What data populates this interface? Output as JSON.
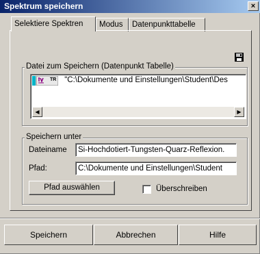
{
  "window": {
    "title": "Spektrum speichern",
    "close_glyph": "×"
  },
  "tabs": [
    {
      "label": "Selektiere Spektren",
      "active": true
    },
    {
      "label": "Modus",
      "active": false
    },
    {
      "label": "Datenpunkttabelle",
      "active": false
    }
  ],
  "file_group": {
    "label": "Datei zum Speichern (Datenpunkt Tabelle)",
    "items": [
      {
        "icon": "spectrum-tr-icon",
        "icon_text": "TR",
        "text": "\"C:\\Dokumente und Einstellungen\\Student\\Des"
      }
    ]
  },
  "save_group": {
    "label": "Speichern unter",
    "filename_label": "Dateiname",
    "filename_value": "Si-Hochdotiert-Tungsten-Quarz-Reflexion.",
    "path_label": "Pfad:",
    "path_value": "C:\\Dokumente und Einstellungen\\Student",
    "choose_path_button": "Pfad auswählen",
    "overwrite_label": "Überschreiben",
    "overwrite_checked": false
  },
  "buttons": {
    "save": "Speichern",
    "cancel": "Abbrechen",
    "help": "Hilfe"
  },
  "colors": {
    "title_start": "#0a246a",
    "title_end": "#a6caf0",
    "face": "#d4d0c8"
  }
}
